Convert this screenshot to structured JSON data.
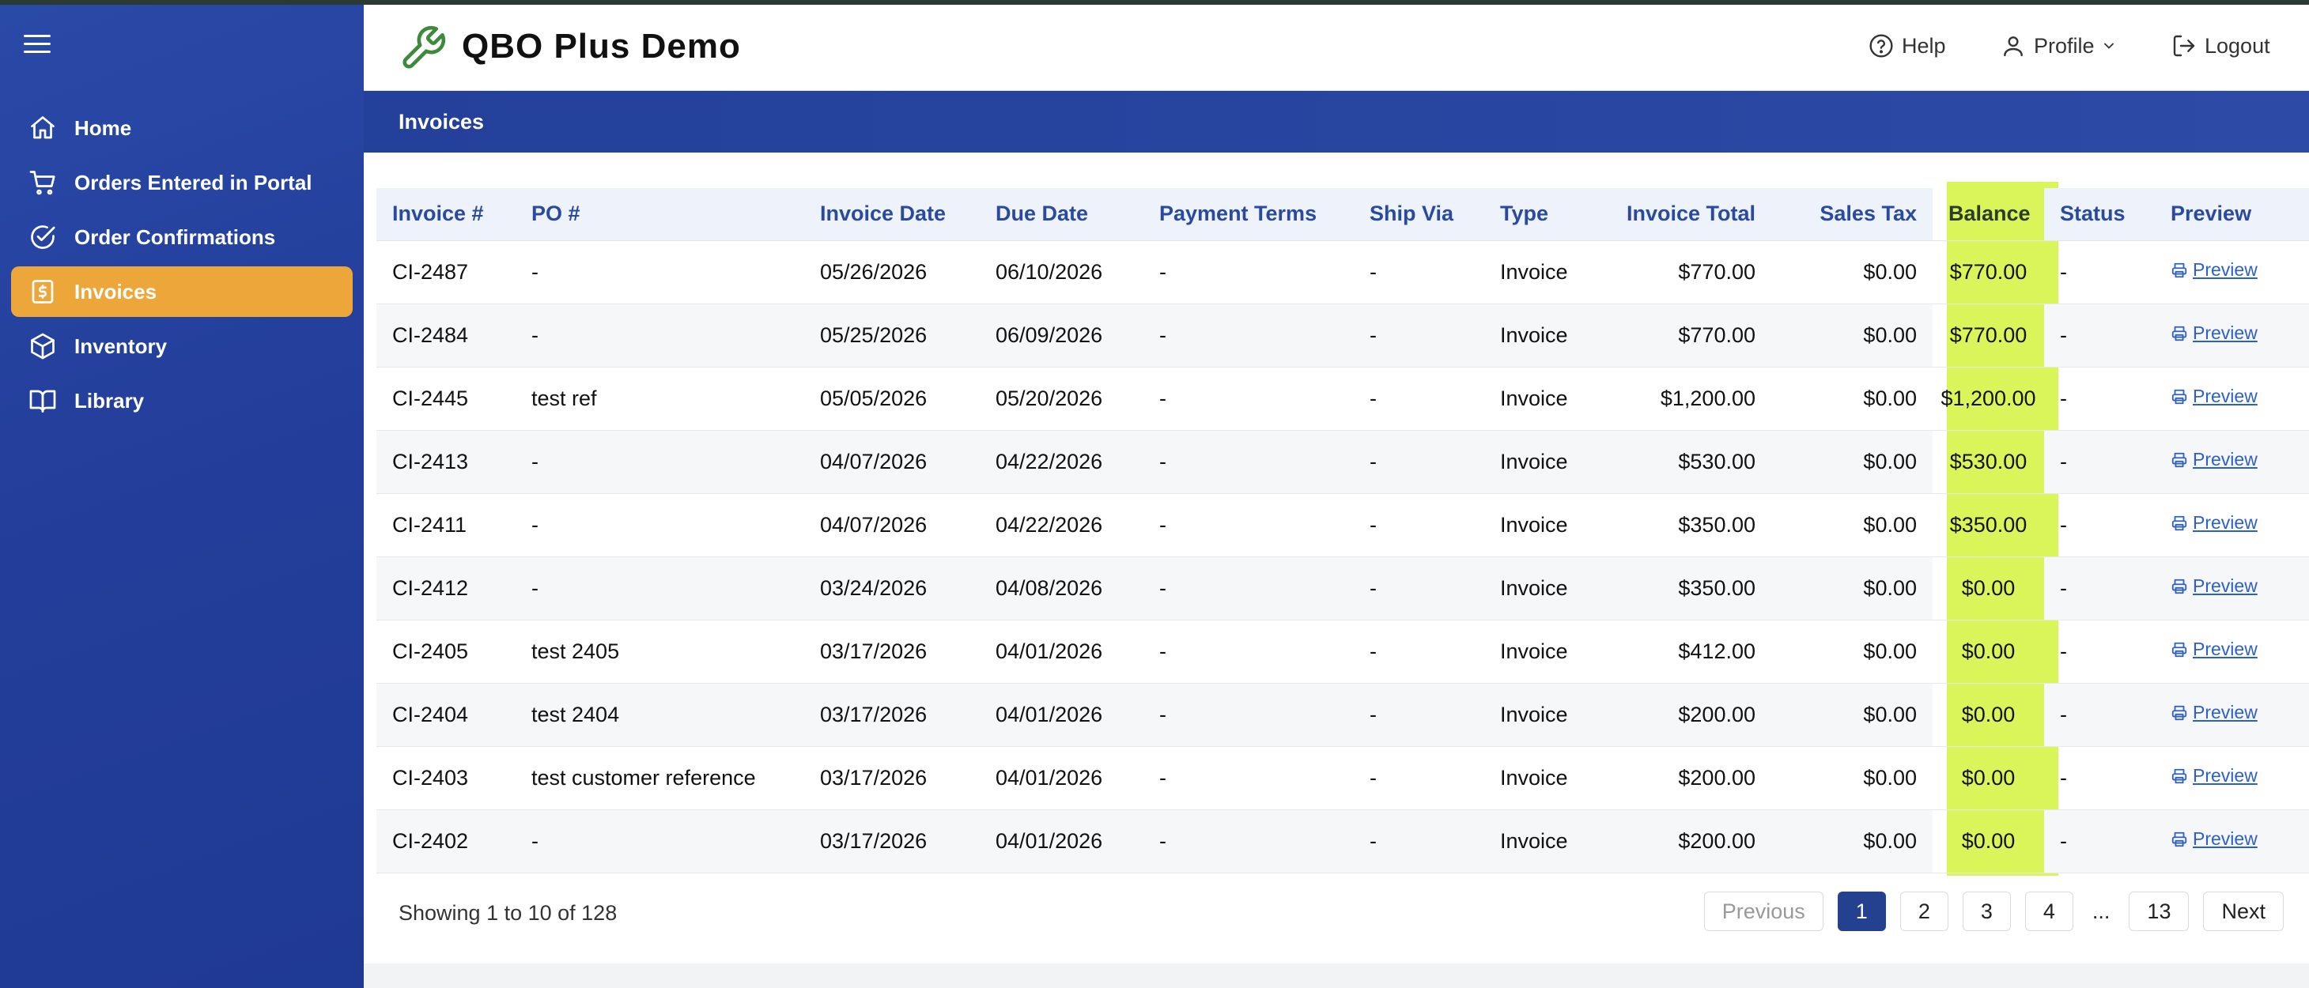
{
  "app": {
    "title": "QBO Plus Demo",
    "brand_icon": "wrench-icon"
  },
  "header": {
    "help_label": "Help",
    "profile_label": "Profile",
    "logout_label": "Logout"
  },
  "sidebar": {
    "items": [
      {
        "label": "Home",
        "icon": "home-icon",
        "active": false
      },
      {
        "label": "Orders Entered in Portal",
        "icon": "cart-icon",
        "active": false
      },
      {
        "label": "Order Confirmations",
        "icon": "check-circle-icon",
        "active": false
      },
      {
        "label": "Invoices",
        "icon": "dollar-doc-icon",
        "active": true
      },
      {
        "label": "Inventory",
        "icon": "box-icon",
        "active": false
      },
      {
        "label": "Library",
        "icon": "book-icon",
        "active": false
      }
    ]
  },
  "section": {
    "title": "Invoices"
  },
  "table": {
    "columns": [
      "Invoice #",
      "PO #",
      "Invoice Date",
      "Due Date",
      "Payment Terms",
      "Ship Via",
      "Type",
      "Invoice Total",
      "Sales Tax",
      "Balance",
      "Status",
      "Preview"
    ],
    "rows": [
      [
        "CI-2487",
        "-",
        "05/26/2026",
        "06/10/2026",
        "-",
        "-",
        "Invoice",
        "$770.00",
        "$0.00",
        "$770.00",
        "-",
        "Preview"
      ],
      [
        "CI-2484",
        "-",
        "05/25/2026",
        "06/09/2026",
        "-",
        "-",
        "Invoice",
        "$770.00",
        "$0.00",
        "$770.00",
        "-",
        "Preview"
      ],
      [
        "CI-2445",
        "test ref",
        "05/05/2026",
        "05/20/2026",
        "-",
        "-",
        "Invoice",
        "$1,200.00",
        "$0.00",
        "$1,200.00",
        "-",
        "Preview"
      ],
      [
        "CI-2413",
        "-",
        "04/07/2026",
        "04/22/2026",
        "-",
        "-",
        "Invoice",
        "$530.00",
        "$0.00",
        "$530.00",
        "-",
        "Preview"
      ],
      [
        "CI-2411",
        "-",
        "04/07/2026",
        "04/22/2026",
        "-",
        "-",
        "Invoice",
        "$350.00",
        "$0.00",
        "$350.00",
        "-",
        "Preview"
      ],
      [
        "CI-2412",
        "-",
        "03/24/2026",
        "04/08/2026",
        "-",
        "-",
        "Invoice",
        "$350.00",
        "$0.00",
        "$0.00",
        "-",
        "Preview"
      ],
      [
        "CI-2405",
        "test 2405",
        "03/17/2026",
        "04/01/2026",
        "-",
        "-",
        "Invoice",
        "$412.00",
        "$0.00",
        "$0.00",
        "-",
        "Preview"
      ],
      [
        "CI-2404",
        "test 2404",
        "03/17/2026",
        "04/01/2026",
        "-",
        "-",
        "Invoice",
        "$200.00",
        "$0.00",
        "$0.00",
        "-",
        "Preview"
      ],
      [
        "CI-2403",
        "test customer reference",
        "03/17/2026",
        "04/01/2026",
        "-",
        "-",
        "Invoice",
        "$200.00",
        "$0.00",
        "$0.00",
        "-",
        "Preview"
      ],
      [
        "CI-2402",
        "-",
        "03/17/2026",
        "04/01/2026",
        "-",
        "-",
        "Invoice",
        "$200.00",
        "$0.00",
        "$0.00",
        "-",
        "Preview"
      ]
    ]
  },
  "pagination": {
    "summary": "Showing 1 to 10 of 128",
    "previous_label": "Previous",
    "next_label": "Next",
    "pages": [
      "1",
      "2",
      "3",
      "4"
    ],
    "ellipsis": "...",
    "last_page": "13",
    "current": "1"
  },
  "colors": {
    "sidebar_bg": "#243f9c",
    "active_item": "#eda63a",
    "balance_highlight": "#d9f55a",
    "header_text": "#2a4aa0",
    "current_page": "#24418f"
  }
}
